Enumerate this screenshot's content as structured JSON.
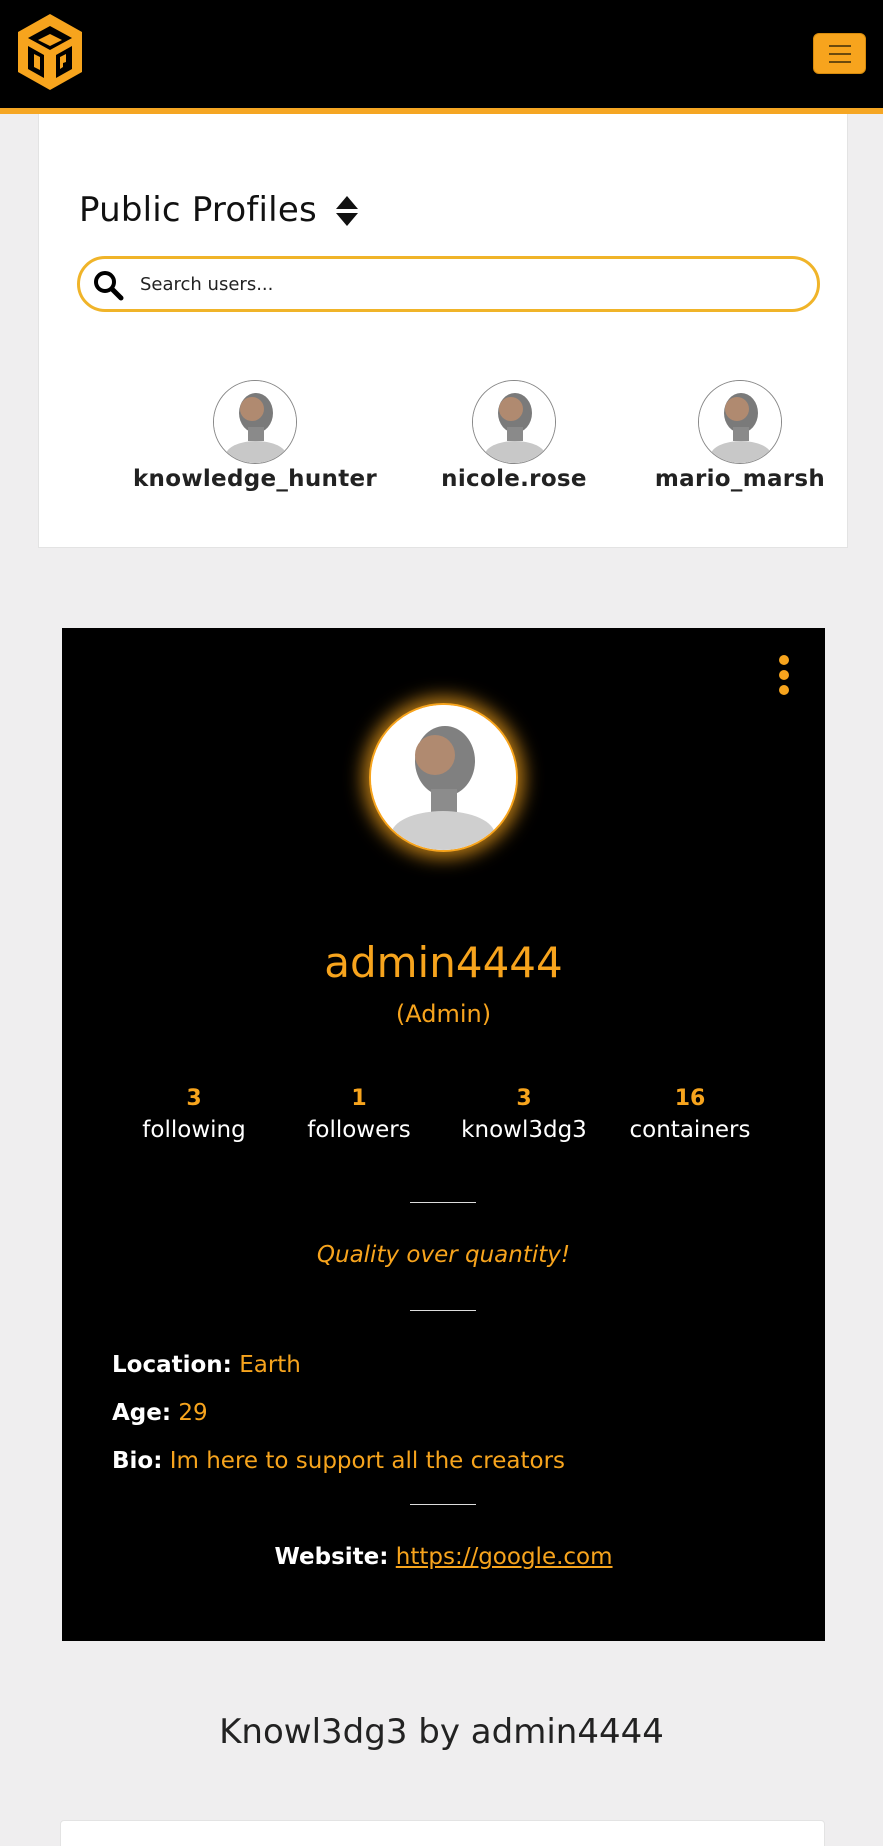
{
  "header": {
    "logo_icon": "cube-cg-logo-icon",
    "menu_icon": "hamburger-icon",
    "accent_color": "#f7a41d"
  },
  "public_profiles": {
    "title": "Public Profiles",
    "sort_icon": "sort-icon",
    "search": {
      "placeholder": "Search users...",
      "value": "",
      "icon": "search-icon"
    },
    "users": [
      {
        "username": "knowledge_hunter"
      },
      {
        "username": "nicole.rose"
      },
      {
        "username": "mario_marsh"
      }
    ]
  },
  "profile": {
    "username": "admin4444",
    "role": "(Admin)",
    "menu_icon": "kebab-menu-icon",
    "stats": [
      {
        "value": "3",
        "label": "following"
      },
      {
        "value": "1",
        "label": "followers"
      },
      {
        "value": "3",
        "label": "knowl3dg3"
      },
      {
        "value": "16",
        "label": "containers"
      }
    ],
    "quote": "Quality over quantity!",
    "location_label": "Location:",
    "location": "Earth",
    "age_label": "Age:",
    "age": "29",
    "bio_label": "Bio:",
    "bio": "Im here to support all the creators",
    "website_label": "Website:",
    "website": "https://google.com"
  },
  "section": {
    "title": "Knowl3dg3 by admin4444"
  }
}
